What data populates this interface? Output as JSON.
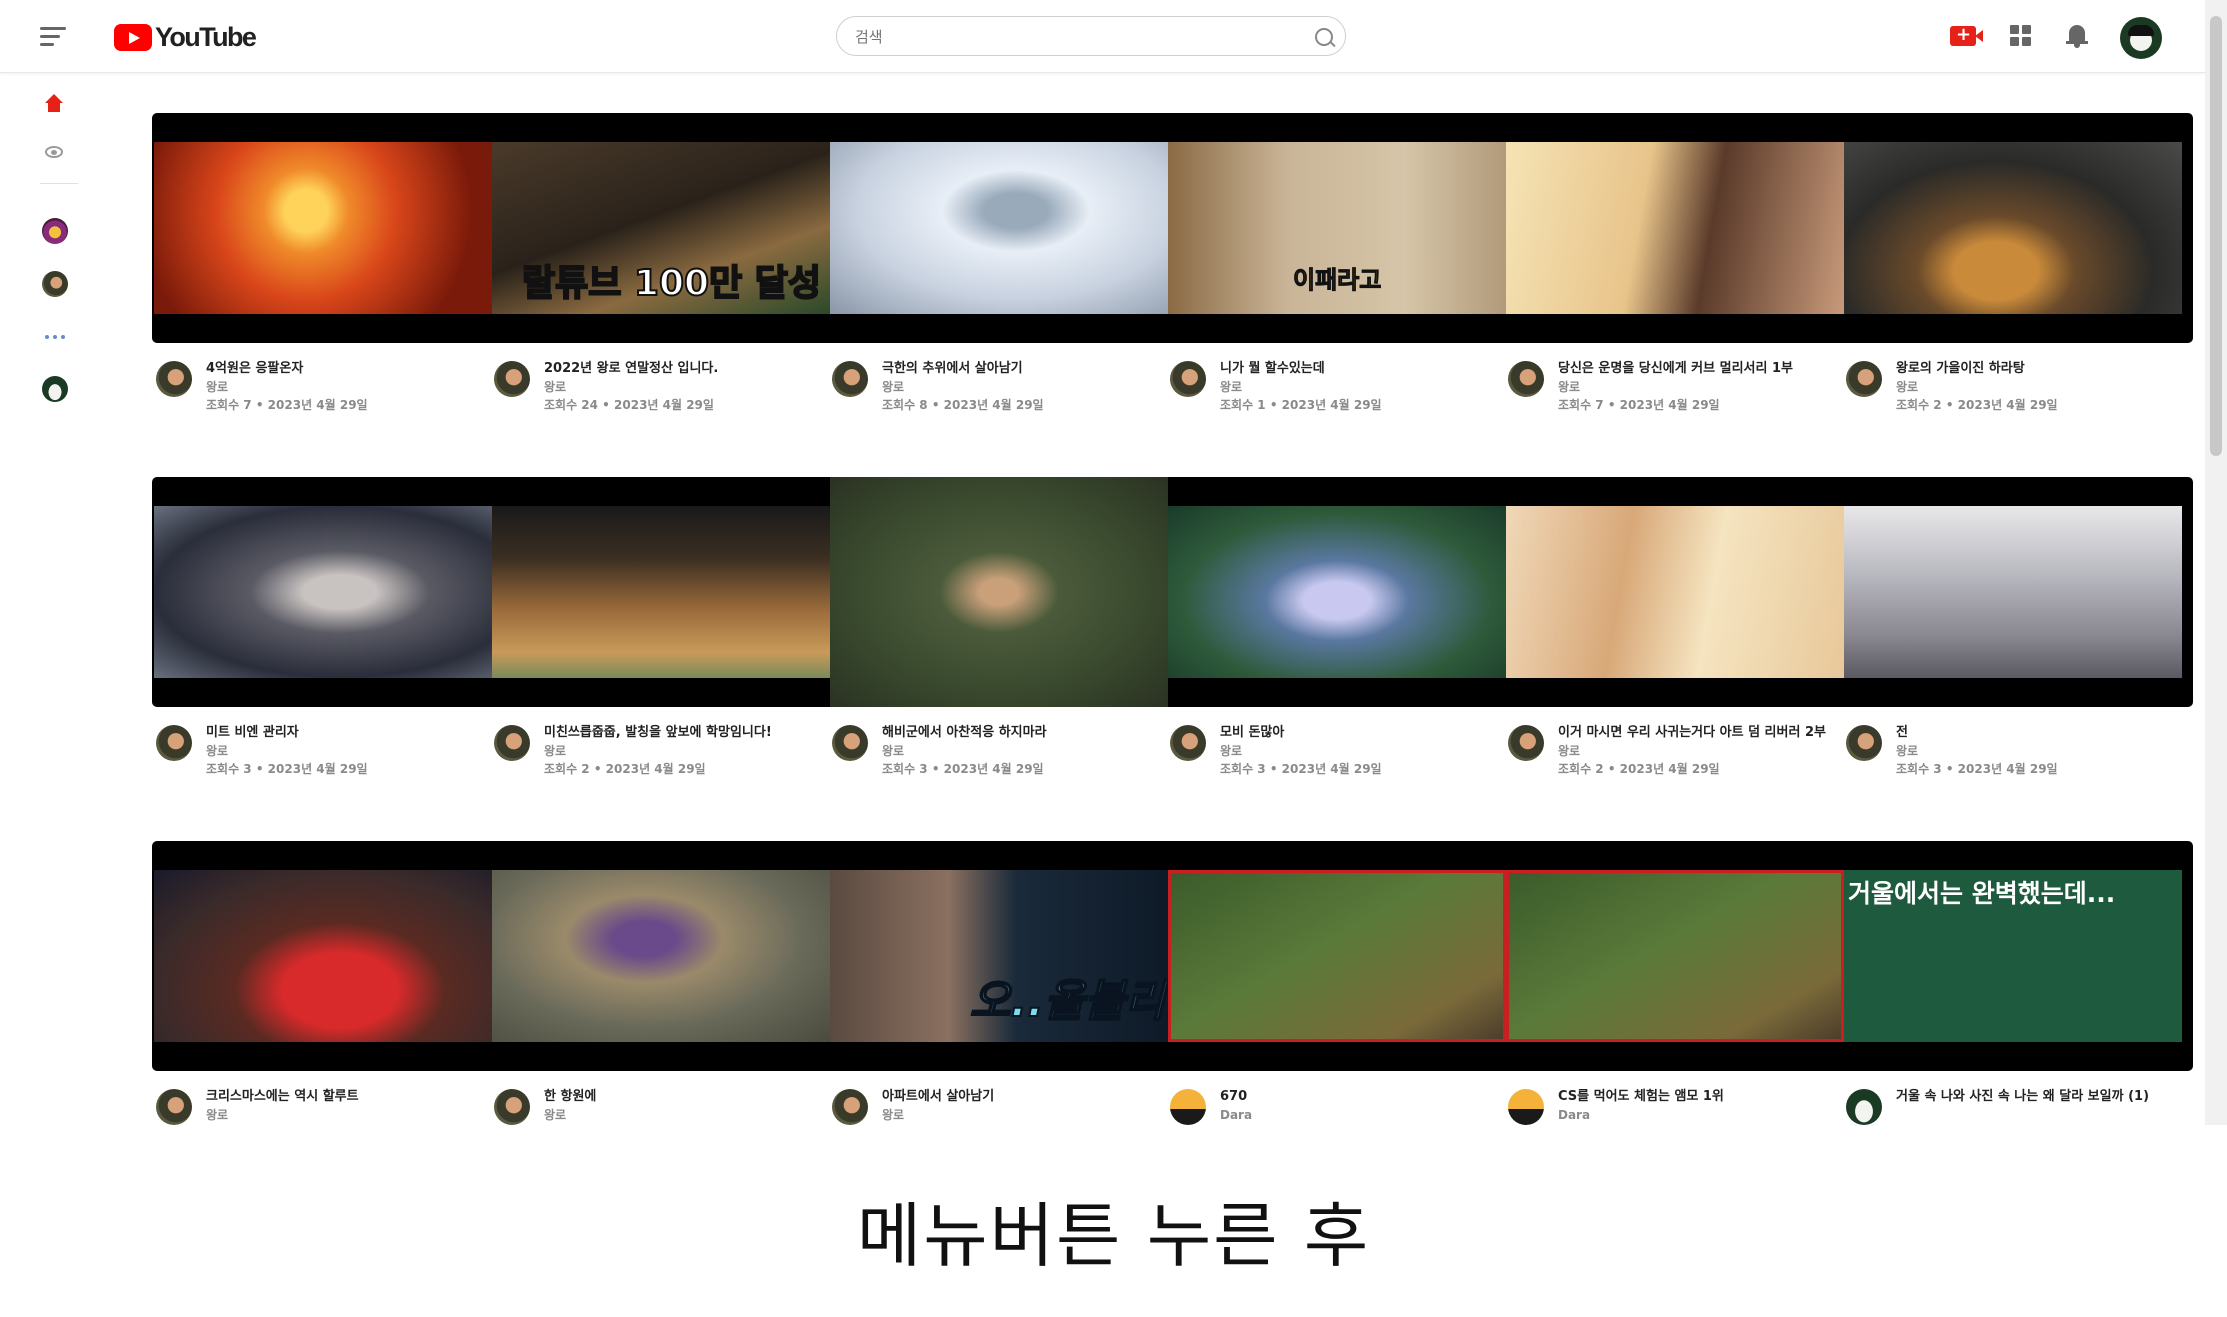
{
  "header": {
    "logo_text": "YouTube",
    "search_placeholder": "검색",
    "icons": [
      "menu-icon",
      "create-video-icon",
      "apps-icon",
      "notifications-icon",
      "account-avatar"
    ]
  },
  "sidebar": {
    "items": [
      {
        "name": "home",
        "icon": "home-icon"
      },
      {
        "name": "subscriptions",
        "icon": "subscriptions-icon"
      },
      {
        "name": "channel-1",
        "icon": "channel-avatar"
      },
      {
        "name": "channel-2",
        "icon": "channel-avatar"
      },
      {
        "name": "more",
        "icon": "more-icon"
      },
      {
        "name": "channel-3",
        "icon": "channel-avatar"
      }
    ]
  },
  "colors": {
    "accent": "#ff0000",
    "text": "#222222",
    "meta": "#8a8a8a"
  },
  "videos": [
    {
      "title": "4억원은 응팔온자",
      "channel": "왕로",
      "stats": "조회수 7 • 2023년 4월 29일",
      "thumb_text": ""
    },
    {
      "title": "2022년 왕로 연말정산 입니다.",
      "channel": "왕로",
      "stats": "조회수 24 • 2023년 4월 29일",
      "thumb_text": "랄튜브 100만 달성"
    },
    {
      "title": "극한의 추위에서 살아남기",
      "channel": "왕로",
      "stats": "조회수 8 • 2023년 4월 29일",
      "thumb_text": ""
    },
    {
      "title": "니가 뭘 할수있는데",
      "channel": "왕로",
      "stats": "조회수 1 • 2023년 4월 29일",
      "thumb_text": "이패라고"
    },
    {
      "title": "당신은 운명을 당신에게 커브 멀리서리 1부",
      "channel": "왕로",
      "stats": "조회수 7 • 2023년 4월 29일",
      "thumb_text": ""
    },
    {
      "title": "왕로의 가을이진 하라탕",
      "channel": "왕로",
      "stats": "조회수 2 • 2023년 4월 29일",
      "thumb_text": ""
    },
    {
      "title": "미트 비엔 관리자",
      "channel": "왕로",
      "stats": "조회수 3 • 2023년 4월 29일",
      "thumb_text": ""
    },
    {
      "title": "미친쓰릅줍줍, 발칭을 앞보에 학망임니다!",
      "channel": "왕로",
      "stats": "조회수 2 • 2023년 4월 29일",
      "thumb_text": ""
    },
    {
      "title": "해비군에서 아찬적응 하지마라",
      "channel": "왕로",
      "stats": "조회수 3 • 2023년 4월 29일",
      "thumb_text": ""
    },
    {
      "title": "모비 돈많아",
      "channel": "왕로",
      "stats": "조회수 3 • 2023년 4월 29일",
      "thumb_text": ""
    },
    {
      "title": "이거 마시면 우리 사귀는거다 아트 덤 리버러 2부",
      "channel": "왕로",
      "stats": "조회수 2 • 2023년 4월 29일",
      "thumb_text": ""
    },
    {
      "title": "전",
      "channel": "왕로",
      "stats": "조회수 3 • 2023년 4월 29일",
      "thumb_text": ""
    },
    {
      "title": "크리스마스에는 역시 할루트",
      "channel": "왕로",
      "stats": "",
      "thumb_text": ""
    },
    {
      "title": "한 항원에",
      "channel": "왕로",
      "stats": "",
      "thumb_text": ""
    },
    {
      "title": "아파트에서 살아남기",
      "channel": "왕로",
      "stats": "",
      "thumb_text": "오..올블리!"
    },
    {
      "title": "670",
      "channel": "Dara",
      "stats": "",
      "thumb_text": ""
    },
    {
      "title": "CS를 먹어도 체험는 앰모 1위",
      "channel": "Dara",
      "stats": "",
      "thumb_text": ""
    },
    {
      "title": "거울 속 나와 사진 속 나는 왜 달라 보일까 (1)",
      "channel": "",
      "stats": "",
      "thumb_text": "거울에서는 완벽했는데..."
    }
  ],
  "caption": "메뉴버튼 누른 후"
}
